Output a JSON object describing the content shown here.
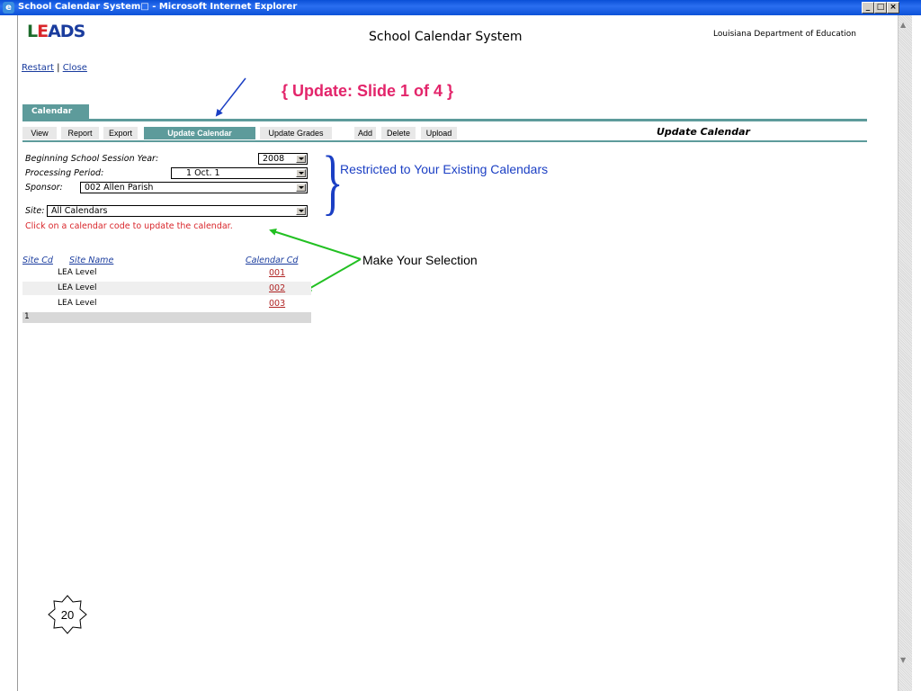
{
  "window": {
    "title": "School Calendar System□ - Microsoft Internet Explorer",
    "minimize": "_",
    "restore": "□",
    "close": "×"
  },
  "header": {
    "logo_part1": "L",
    "logo_part2": "E",
    "logo_part3": "ADS",
    "app_title": "School Calendar System",
    "department": "Louisiana Department of Education"
  },
  "links": {
    "restart": "Restart",
    "separator": " | ",
    "close": "Close"
  },
  "slide_note": "{ Update:  Slide 1 of 4 }",
  "tabs": [
    {
      "label": "Calendar"
    }
  ],
  "menu": {
    "items": [
      {
        "label": "View"
      },
      {
        "label": "Report"
      },
      {
        "label": "Export"
      },
      {
        "label": "Update Calendar",
        "active": true
      },
      {
        "label": "Update Grades"
      },
      {
        "label": "Add"
      },
      {
        "label": "Delete"
      },
      {
        "label": "Upload"
      }
    ],
    "page_title": "Update Calendar"
  },
  "form": {
    "year_label": "Beginning School Session Year:",
    "year_value": "2008",
    "period_label": "Processing Period:",
    "period_value": "1 Oct. 1",
    "sponsor_label": "Sponsor:",
    "sponsor_value": "002 Allen Parish",
    "site_label": "Site:",
    "site_value": "All Calendars",
    "instruction": "Click on a calendar code to update the calendar."
  },
  "annotations": {
    "restricted": "Restricted to Your Existing Calendars",
    "make_selection": "Make Your Selection"
  },
  "table": {
    "headers": {
      "site_cd": "Site Cd",
      "site_name": "Site Name",
      "calendar_cd": "Calendar Cd"
    },
    "rows": [
      {
        "site_name": "LEA Level",
        "calendar_cd": "001"
      },
      {
        "site_name": "LEA Level",
        "calendar_cd": "002"
      },
      {
        "site_name": "LEA Level",
        "calendar_cd": "003"
      }
    ],
    "footer_page": "1"
  },
  "page_number": "20",
  "colors": {
    "teal": "#5d9b9b",
    "annotation_blue": "#1b3fc4",
    "annotation_green": "#22c022",
    "slide_pink": "#e3256b"
  }
}
